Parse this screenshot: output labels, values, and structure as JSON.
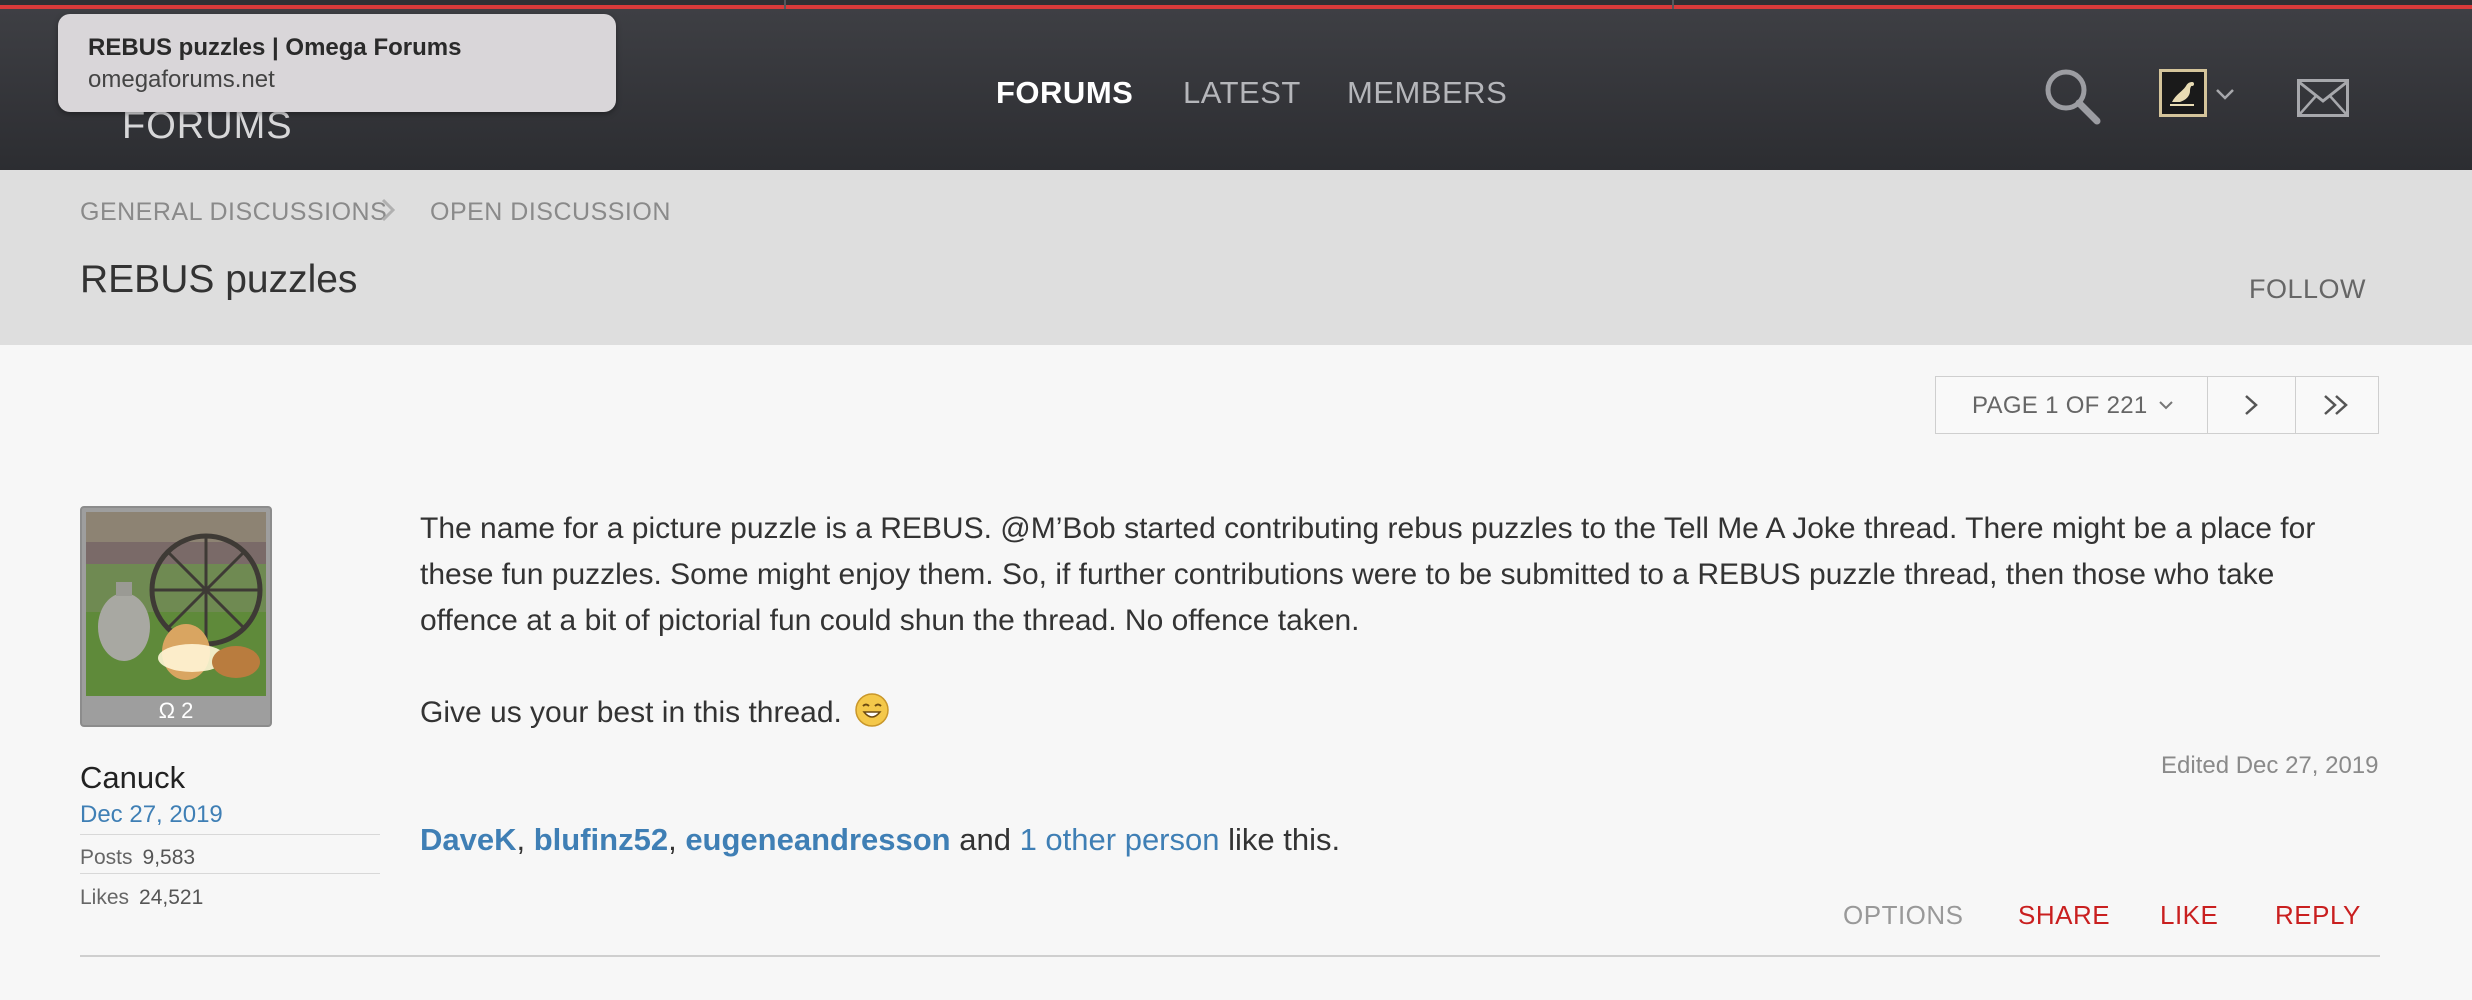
{
  "tooltip": {
    "title": "REBUS puzzles | Omega Forums",
    "url": "omegaforums.net"
  },
  "header": {
    "logo_text": "FORUMS",
    "nav": [
      {
        "label": "FORUMS",
        "active": true
      },
      {
        "label": "LATEST",
        "active": false
      },
      {
        "label": "MEMBERS",
        "active": false
      }
    ],
    "icons": [
      "search-icon",
      "user-avatar",
      "chevron-down-icon",
      "mail-icon"
    ]
  },
  "breadcrumb": {
    "items": [
      "GENERAL DISCUSSIONS",
      "OPEN DISCUSSION"
    ]
  },
  "thread": {
    "title": "REBUS puzzles",
    "follow_label": "FOLLOW"
  },
  "pager": {
    "label": "PAGE 1 OF 221",
    "current_page": 1,
    "total_pages": 221
  },
  "post": {
    "avatar_caption": "Ω 2",
    "username": "Canuck",
    "date": "Dec 27, 2019",
    "stats": [
      {
        "label": "Posts",
        "value": "9,583"
      },
      {
        "label": "Likes",
        "value": "24,521"
      }
    ],
    "body_paragraph_1": "The name for a picture puzzle is a REBUS. @M’Bob started contributing rebus puzzles to the Tell Me A Joke thread. There might be a place for these fun puzzles. Some might enjoy them. So, if further contributions were to be submitted to a REBUS puzzle thread, then those who take offence at a bit of pictorial fun could shun the thread. No offence taken.",
    "body_paragraph_2": "Give us your best in this thread.",
    "edited": "Edited Dec 27, 2019",
    "likes": {
      "users": [
        "DaveK",
        "blufinz52",
        "eugeneandresson"
      ],
      "sep": ", ",
      "and_text": " and ",
      "other_link": "1 other person",
      "suffix": " like this."
    },
    "actions": [
      "OPTIONS",
      "SHARE",
      "LIKE",
      "REPLY"
    ]
  },
  "colors": {
    "link": "#3f7fb5",
    "action_red": "#c91f1f",
    "header": "#36373b",
    "accent_red": "#d83a3a"
  }
}
